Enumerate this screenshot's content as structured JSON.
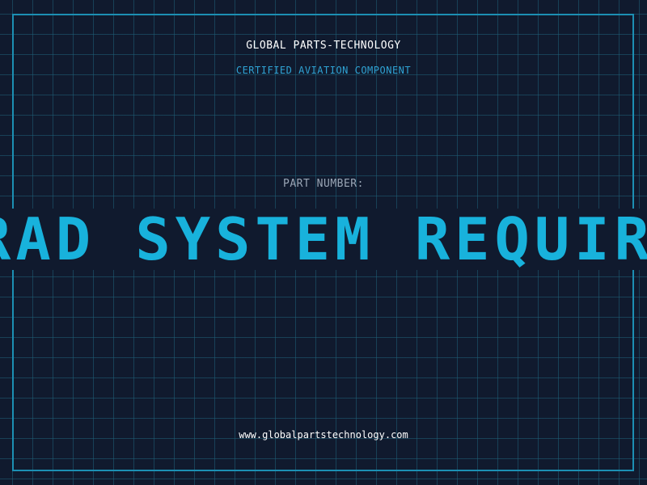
{
  "header": {
    "company": "GLOBAL PARTS-TECHNOLOGY",
    "subtitle": "CERTIFIED AVIATION COMPONENT"
  },
  "part": {
    "label": "PART NUMBER:",
    "value": "RAD SYSTEM REQUIRED"
  },
  "footer": {
    "url": "www.globalpartstechnology.com"
  },
  "colors": {
    "background": "#101a2e",
    "grid": "#206078",
    "frame": "#1c8fb3",
    "accent": "#18b2dc",
    "subtitle": "#2fa3d4",
    "label": "#9aa6b6",
    "text": "#ffffff"
  }
}
